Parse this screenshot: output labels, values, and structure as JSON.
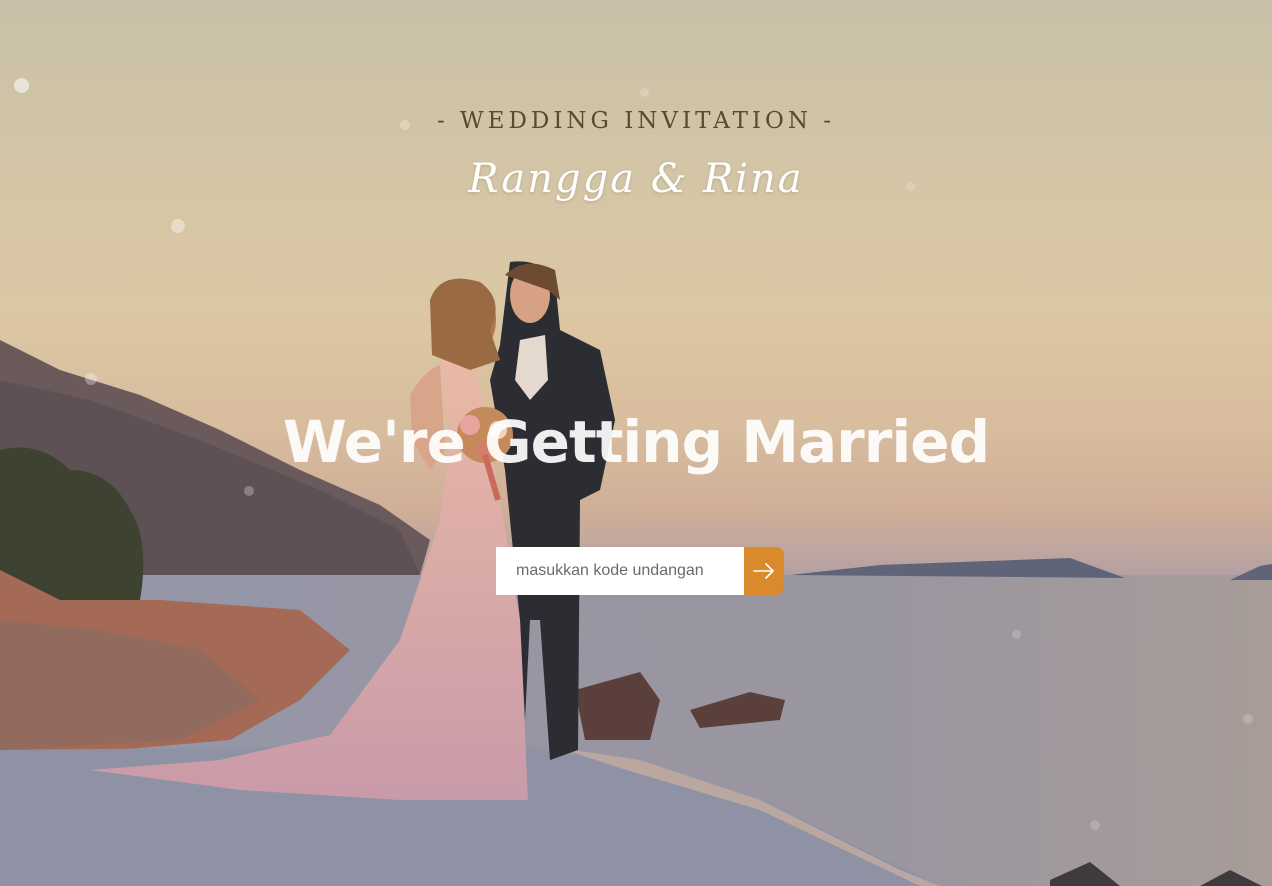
{
  "invitation": {
    "kicker": "- WEDDING INVITATION -",
    "couple_names": "Rangga & Rina",
    "headline": "We're Getting Married"
  },
  "code_form": {
    "placeholder": "masukkan kode undangan",
    "submit_icon": "arrow-right-icon"
  },
  "colors": {
    "accent": "#d98a2a",
    "kicker_text": "#5b4a32",
    "headline_text": "#ffffff"
  }
}
